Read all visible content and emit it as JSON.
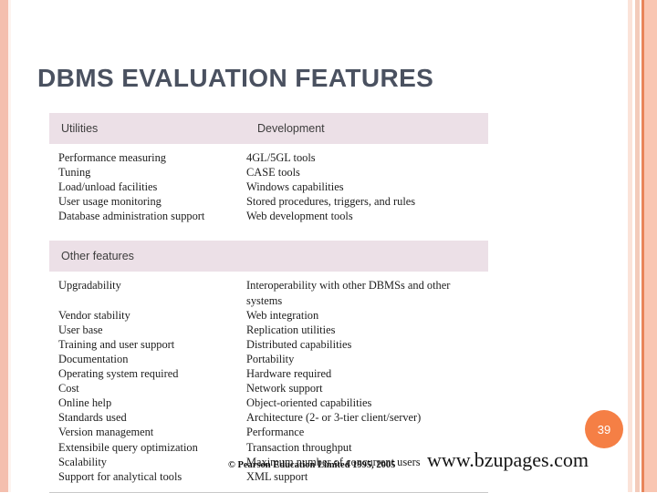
{
  "slide": {
    "title": "DBMS EVALUATION FEATURES",
    "page_number": "39",
    "copyright": "© Pearson Education Limited 1995, 2005",
    "watermark": "www.bzupages.com"
  },
  "colors": {
    "title": "#4a5160",
    "band": "#ece0e7",
    "badge": "#f57f45",
    "stripe_accent": "#e8855a",
    "stripe_light": "#f9c6b2"
  },
  "table": {
    "sections": [
      {
        "headers": [
          "Utilities",
          "Development"
        ],
        "rows": [
          [
            "Performance measuring",
            "4GL/5GL tools"
          ],
          [
            "Tuning",
            "CASE tools"
          ],
          [
            "Load/unload facilities",
            "Windows capabilities"
          ],
          [
            "User usage monitoring",
            "Stored procedures, triggers, and rules"
          ],
          [
            "Database administration support",
            "Web development tools"
          ]
        ]
      },
      {
        "headers": [
          "Other features",
          ""
        ],
        "rows": [
          [
            "Upgradability",
            "Interoperability with other DBMSs and other systems"
          ],
          [
            "Vendor stability",
            "Web integration"
          ],
          [
            "User base",
            "Replication utilities"
          ],
          [
            "Training and user support",
            "Distributed capabilities"
          ],
          [
            "Documentation",
            "Portability"
          ],
          [
            "Operating system required",
            "Hardware required"
          ],
          [
            "Cost",
            "Network support"
          ],
          [
            "Online help",
            "Object-oriented capabilities"
          ],
          [
            "Standards used",
            "Architecture (2- or 3-tier client/server)"
          ],
          [
            "Version management",
            "Performance"
          ],
          [
            "Extensibile query optimization",
            "Transaction throughput"
          ],
          [
            "Scalability",
            "Maximum number of concurrent users"
          ],
          [
            "Support for analytical tools",
            "XML support"
          ]
        ]
      }
    ]
  }
}
